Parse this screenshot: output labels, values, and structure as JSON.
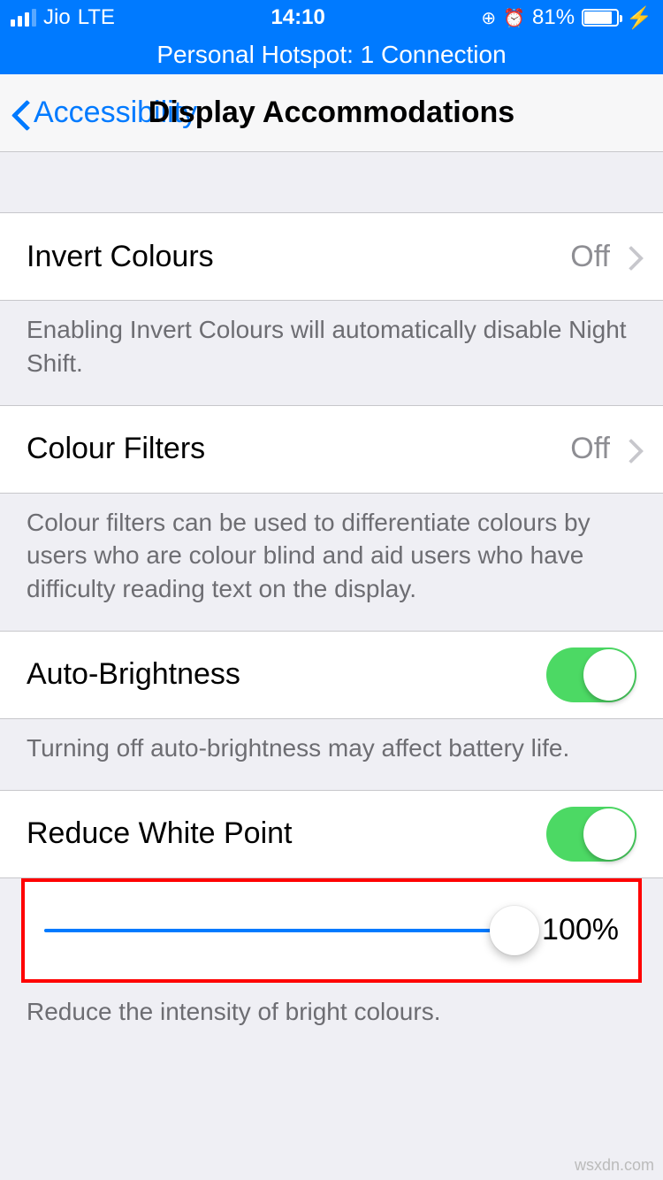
{
  "status": {
    "carrier": "Jio",
    "network": "LTE",
    "time": "14:10",
    "battery_percent": "81%",
    "battery_fill": 81
  },
  "hotspot": {
    "text": "Personal Hotspot: 1 Connection"
  },
  "nav": {
    "back_label": "Accessibility",
    "title": "Display Accommodations"
  },
  "rows": {
    "invert": {
      "label": "Invert Colours",
      "value": "Off"
    },
    "invert_footer": "Enabling Invert Colours will automatically disable Night Shift.",
    "filters": {
      "label": "Colour Filters",
      "value": "Off"
    },
    "filters_footer": "Colour filters can be used to differentiate colours by users who are colour blind and aid users who have difficulty reading text on the display.",
    "auto_brightness": {
      "label": "Auto-Brightness",
      "on": true
    },
    "auto_brightness_footer": "Turning off auto-brightness may affect battery life.",
    "reduce_white_point": {
      "label": "Reduce White Point",
      "on": true,
      "value": "100%"
    },
    "reduce_white_point_footer": "Reduce the intensity of bright colours."
  },
  "watermark": "wsxdn.com"
}
